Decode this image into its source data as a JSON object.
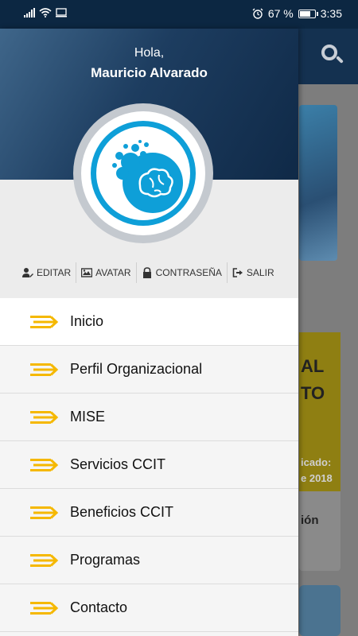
{
  "status_bar": {
    "battery_percent": "67 %",
    "time": "3:35",
    "icons": [
      "signal-icon",
      "wifi-icon",
      "screen-cast-icon",
      "alarm-icon",
      "battery-icon"
    ]
  },
  "drawer": {
    "greeting": "Hola,",
    "user_name": "Mauricio Alvarado",
    "actions": [
      {
        "label": "EDITAR",
        "icon": "user-edit-icon"
      },
      {
        "label": "AVATAR",
        "icon": "image-icon"
      },
      {
        "label": "CONTRASEÑA",
        "icon": "lock-icon"
      },
      {
        "label": "SALIR",
        "icon": "sign-out-icon"
      }
    ],
    "menu": [
      {
        "label": "Inicio",
        "active": true
      },
      {
        "label": "Perfil Organizacional",
        "active": false
      },
      {
        "label": "MISE",
        "active": false
      },
      {
        "label": "Servicios CCIT",
        "active": false
      },
      {
        "label": "Beneficios CCIT",
        "active": false
      },
      {
        "label": "Programas",
        "active": false
      },
      {
        "label": "Contacto",
        "active": false
      }
    ]
  },
  "background": {
    "card_text_1": "AL",
    "card_text_2": "TO",
    "card_text_3": "icado:",
    "card_text_4": "e 2018",
    "card_text_5": "ión"
  },
  "colors": {
    "accent_yellow": "#f5b800",
    "header_dark": "#0c2742",
    "logo_blue": "#0e9fd8"
  }
}
